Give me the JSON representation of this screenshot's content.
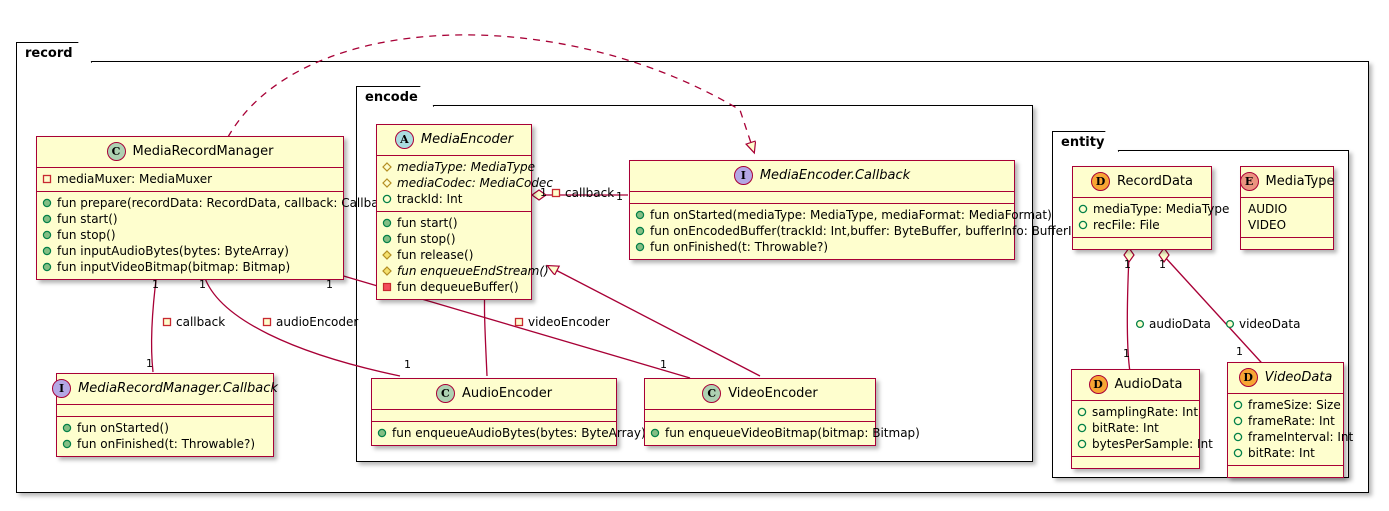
{
  "diagram": {
    "type": "uml-class-diagram",
    "colors": {
      "class_fill": "#FEFECE",
      "class_border": "#A80036",
      "line": "#A80036",
      "package_border": "#000000",
      "background": "#FFFFFF",
      "badge_class": "#ADD1B2",
      "badge_abstract": "#A9DCDF",
      "badge_interface": "#B4A7E5",
      "badge_data": "#F7A534",
      "badge_enum": "#EB937F",
      "public_marker": "#038048",
      "protected_marker": "#B38D22",
      "private_marker": "#C82930"
    }
  },
  "packages": [
    {
      "name": "record"
    },
    {
      "name": "encode"
    },
    {
      "name": "entity"
    }
  ],
  "classes": {
    "media_record_manager": {
      "name": "MediaRecordManager",
      "stereotype": "C",
      "attributes": [
        {
          "visibility": "private",
          "text": "mediaMuxer: MediaMuxer"
        }
      ],
      "methods": [
        {
          "visibility": "public",
          "text": "fun prepare(recordData: RecordData, callback: Callback?)"
        },
        {
          "visibility": "public",
          "text": "fun start()"
        },
        {
          "visibility": "public",
          "text": "fun stop()"
        },
        {
          "visibility": "public",
          "text": "fun inputAudioBytes(bytes: ByteArray)"
        },
        {
          "visibility": "public",
          "text": "fun inputVideoBitmap(bitmap: Bitmap)"
        }
      ]
    },
    "media_record_manager_callback": {
      "name": "MediaRecordManager.Callback",
      "stereotype": "I",
      "attributes": [],
      "methods": [
        {
          "visibility": "public",
          "text": "fun onStarted()"
        },
        {
          "visibility": "public",
          "text": "fun onFinished(t: Throwable?)"
        }
      ]
    },
    "media_encoder": {
      "name": "MediaEncoder",
      "stereotype": "A",
      "attributes": [
        {
          "visibility": "protected",
          "text": "mediaType: MediaType",
          "italic": true
        },
        {
          "visibility": "protected",
          "text": "mediaCodec: MediaCodec",
          "italic": true
        },
        {
          "visibility": "public_hollow",
          "text": "trackId: Int"
        }
      ],
      "methods": [
        {
          "visibility": "public",
          "text": "fun start()"
        },
        {
          "visibility": "public",
          "text": "fun stop()"
        },
        {
          "visibility": "protected_filled",
          "text": "fun release()"
        },
        {
          "visibility": "protected_filled",
          "text": "fun enqueueEndStream()",
          "italic": true
        },
        {
          "visibility": "private_filled",
          "text": "fun dequeueBuffer()"
        }
      ]
    },
    "media_encoder_callback": {
      "name": "MediaEncoder.Callback",
      "stereotype": "I",
      "attributes": [],
      "methods": [
        {
          "visibility": "public",
          "text": "fun onStarted(mediaType: MediaType, mediaFormat: MediaFormat)"
        },
        {
          "visibility": "public",
          "text": "fun onEncodedBuffer(trackId: Int,buffer: ByteBuffer, bufferInfo: BufferInfo)"
        },
        {
          "visibility": "public",
          "text": "fun onFinished(t: Throwable?)"
        }
      ]
    },
    "audio_encoder": {
      "name": "AudioEncoder",
      "stereotype": "C",
      "attributes": [],
      "methods": [
        {
          "visibility": "public",
          "text": "fun enqueueAudioBytes(bytes: ByteArray)"
        }
      ]
    },
    "video_encoder": {
      "name": "VideoEncoder",
      "stereotype": "C",
      "attributes": [],
      "methods": [
        {
          "visibility": "public",
          "text": "fun enqueueVideoBitmap(bitmap: Bitmap)"
        }
      ]
    },
    "record_data": {
      "name": "RecordData",
      "stereotype": "D",
      "attributes": [
        {
          "visibility": "public_hollow",
          "text": "mediaType: MediaType"
        },
        {
          "visibility": "public_hollow",
          "text": "recFile: File"
        }
      ],
      "methods": []
    },
    "media_type": {
      "name": "MediaType",
      "stereotype": "E",
      "values": [
        "AUDIO",
        "VIDEO"
      ],
      "methods": []
    },
    "audio_data": {
      "name": "AudioData",
      "stereotype": "D",
      "attributes": [
        {
          "visibility": "public_hollow",
          "text": "samplingRate: Int"
        },
        {
          "visibility": "public_hollow",
          "text": "bitRate: Int"
        },
        {
          "visibility": "public_hollow",
          "text": "bytesPerSample: Int"
        }
      ],
      "methods": []
    },
    "video_data": {
      "name": "VideoData",
      "stereotype": "D",
      "attributes": [
        {
          "visibility": "public_hollow",
          "text": "frameSize: Size"
        },
        {
          "visibility": "public_hollow",
          "text": "frameRate: Int"
        },
        {
          "visibility": "public_hollow",
          "text": "frameInterval: Int"
        },
        {
          "visibility": "public_hollow",
          "text": "bitRate: Int"
        }
      ],
      "methods": []
    }
  },
  "edge_labels": {
    "callback_left": {
      "text": "callback",
      "marker": "private"
    },
    "audio_encoder": {
      "text": "audioEncoder",
      "marker": "private"
    },
    "video_encoder": {
      "text": "videoEncoder",
      "marker": "private"
    },
    "callback_mid": {
      "text": "callback",
      "marker": "private"
    },
    "audio_data": {
      "text": "audioData",
      "marker": "public_hollow"
    },
    "video_data": {
      "text": "videoData",
      "marker": "public_hollow"
    }
  },
  "multiplicities": {
    "m1": "1",
    "m2": "1",
    "m3": "1",
    "m4": "1",
    "m5": "1",
    "m6": "1",
    "m7": "1",
    "m8": "1",
    "m9": "1",
    "m10": "1",
    "m11": "1",
    "m12": "1"
  }
}
